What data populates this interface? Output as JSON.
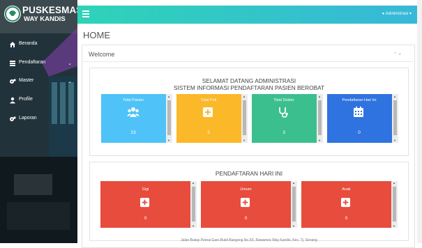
{
  "app": {
    "logo_line1": "PUSKESMAS",
    "logo_line2": "WAY KANDIS"
  },
  "sidebar": {
    "items": [
      {
        "label": "Beranda",
        "icon": "home-icon",
        "has_chevron": false
      },
      {
        "label": "Pendaftaran",
        "icon": "list-icon",
        "has_chevron": true
      },
      {
        "label": "Master",
        "icon": "gears-icon",
        "has_chevron": true
      },
      {
        "label": "Profile",
        "icon": "user-icon",
        "has_chevron": false
      },
      {
        "label": "Laporan",
        "icon": "gears-icon",
        "has_chevron": false
      }
    ]
  },
  "topbar": {
    "menu_icon": "hamburger-icon",
    "user_label": "Administrasi"
  },
  "main": {
    "page_title": "HOME",
    "panel": {
      "title": "Welcome",
      "controls": [
        "^",
        "×"
      ]
    },
    "welcome_line1": "SELAMAT DATANG ADMINISTRASI",
    "welcome_line2": "SISTEM INFORMASI PENDAFTARAN PASIEN BEROBAT",
    "stats": [
      {
        "title": "Total Pasien",
        "value": "23",
        "icon": "users-icon",
        "color": "#4fc3f7"
      },
      {
        "title": "Total Poli",
        "value": "3",
        "icon": "plus-square-icon",
        "color": "#fbb829"
      },
      {
        "title": "Total Dokter",
        "value": "3",
        "icon": "stethoscope-icon",
        "color": "#3cbf8f"
      },
      {
        "title": "Pendaftaran Hari Ini",
        "value": "0",
        "icon": "calendar-icon",
        "color": "#2f73e0"
      }
    ],
    "today_title": "PENDAFTARAN HARI INI",
    "today": [
      {
        "title": "Gigi",
        "value": "0",
        "icon": "plus-square-icon"
      },
      {
        "title": "Umum",
        "value": "0",
        "icon": "plus-square-icon"
      },
      {
        "title": "Anak",
        "value": "0",
        "icon": "plus-square-icon"
      }
    ],
    "footer": "Jalan Bukay Pemai Garo Bukit Bangong No.XII, Rawamos Way Kandis, Kec. Tj. Senang"
  },
  "colors": {
    "topbar_start": "#2ed3b8",
    "topbar_end": "#37b8d8",
    "red_tile": "#e74c3c"
  }
}
